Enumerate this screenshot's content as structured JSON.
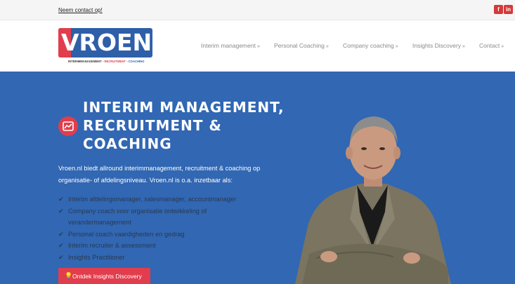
{
  "topbar": {
    "contact_link": "Neem contact op!",
    "facebook_icon": "facebook-icon",
    "linkedin_icon": "linkedin-icon"
  },
  "logo": {
    "text": "VROEN",
    "tagline_interim": "INTERIMMANAGEMENT",
    "tagline_recruitment": "RECRUITMENT",
    "tagline_coaching": "COACHING"
  },
  "nav": {
    "items": [
      {
        "label": "Interim management"
      },
      {
        "label": "Personal Coaching"
      },
      {
        "label": "Company coaching"
      },
      {
        "label": "Insights Discovery"
      },
      {
        "label": "Contact"
      }
    ],
    "chevron": "»"
  },
  "hero": {
    "title_line1": "INTERIM MANAGEMENT,",
    "title_line2": "RECRUITMENT &",
    "title_line3": "COACHING",
    "intro": "Vroen.nl biedt allround interimmanagement, recruitment & coaching op organisatie- of afdelingsniveau. Vroen.nl is o.a. inzetbaar als:",
    "checklist": [
      "Interim afdelingsmanager, salesmanager, accountmanager",
      "Company coach voor organisatie ontwikkeling of verandermanagement",
      "Personal coach vaardigheden en gedrag",
      "Interim recruiter & assessment",
      "Insights Practitioner"
    ],
    "cta_label": "Ontdek Insights Discovery"
  },
  "colors": {
    "hero_bg": "#3167b3",
    "accent_red": "#e23d4c",
    "logo_blue": "#2f5fa8"
  }
}
